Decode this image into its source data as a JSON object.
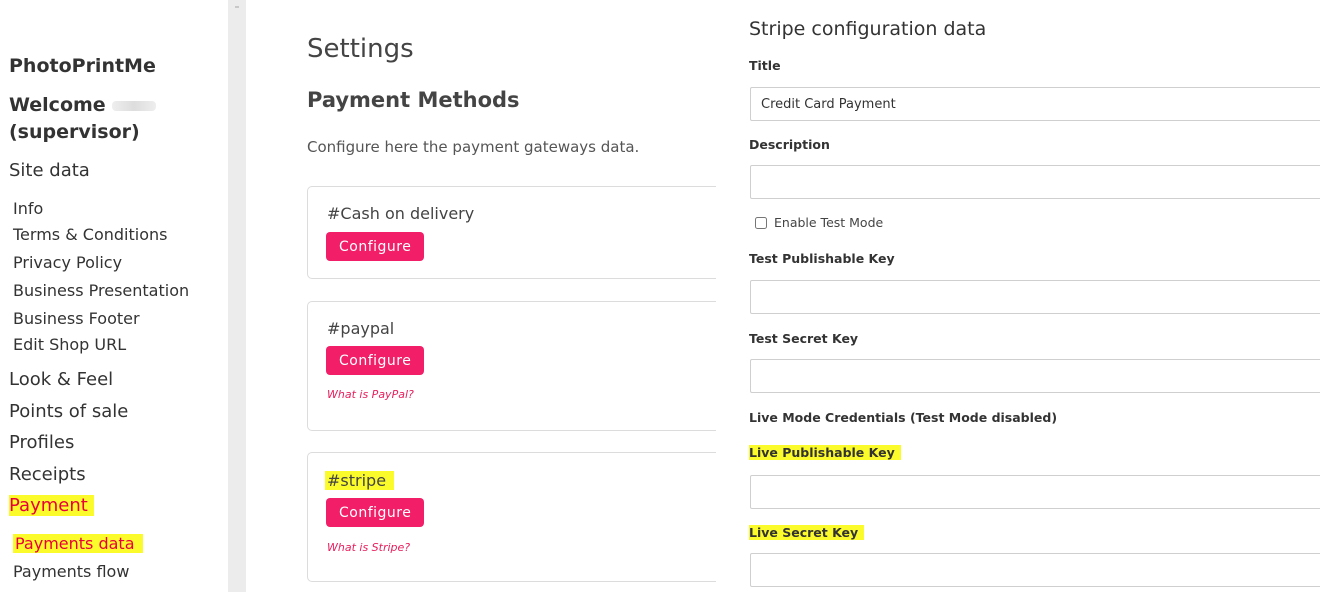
{
  "sidebar": {
    "brand": "PhotoPrintMe",
    "welcome_line1": "Welcome",
    "welcome_line2": "(supervisor)",
    "site_data": "Site data",
    "site_items": [
      "Info",
      "Terms & Conditions",
      "Privacy Policy",
      "Business Presentation",
      "Business Footer",
      "Edit Shop URL"
    ],
    "look_feel": "Look & Feel",
    "points_of_sale": "Points of sale",
    "profiles": "Profiles",
    "receipts": "Receipts",
    "payment": "Payment",
    "payments_data": "Payments data",
    "payments_flow": "Payments flow"
  },
  "main": {
    "title": "Settings",
    "subtitle": "Payment Methods",
    "description": "Configure here the payment gateways data.",
    "cards": [
      {
        "title": "#Cash on delivery",
        "button": "Configure",
        "link": ""
      },
      {
        "title": "#paypal",
        "button": "Configure",
        "link": "What is PayPal?"
      },
      {
        "title": "#stripe",
        "button": "Configure",
        "link": "What is Stripe?"
      }
    ]
  },
  "stripe_panel": {
    "heading": "Stripe configuration data",
    "title_label": "Title",
    "title_value": "Credit Card Payment",
    "description_label": "Description",
    "description_value": "",
    "test_mode_label": "Enable Test Mode",
    "test_publishable_label": "Test Publishable Key",
    "test_secret_label": "Test Secret Key",
    "live_section_label": "Live Mode Credentials (Test Mode disabled)",
    "live_publishable_label": "Live Publishable Key",
    "live_secret_label": "Live Secret Key"
  },
  "colors": {
    "accent": "#f21e67",
    "highlight": "#fbfb2b",
    "link": "#e8205e"
  }
}
